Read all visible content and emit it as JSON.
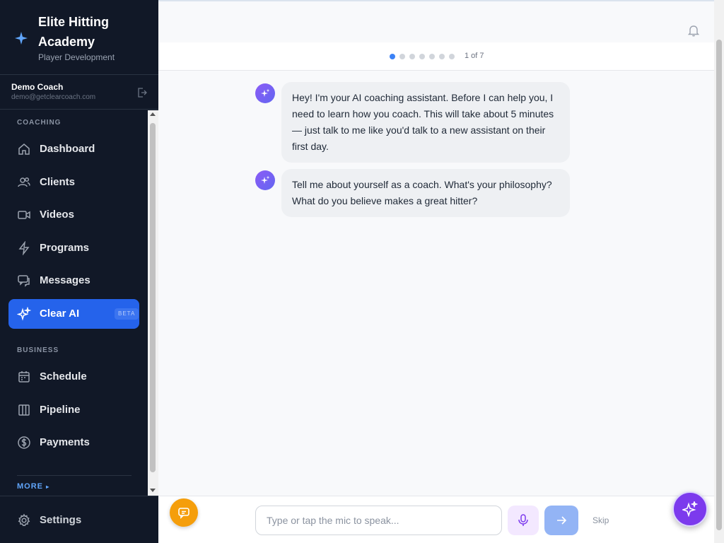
{
  "brand": {
    "title": "Elite Hitting Academy",
    "subtitle": "Player Development",
    "star_icon": "sparkle-icon"
  },
  "user": {
    "name": "Demo Coach",
    "email": "demo@getclearcoach.com",
    "logout_icon": "logout-icon"
  },
  "nav": {
    "coaching_label": "COACHING",
    "business_label": "BUSINESS",
    "more_label": "MORE",
    "items": [
      {
        "label": "Dashboard",
        "icon": "home-icon"
      },
      {
        "label": "Clients",
        "icon": "users-icon"
      },
      {
        "label": "Videos",
        "icon": "video-icon"
      },
      {
        "label": "Programs",
        "icon": "bolt-icon"
      },
      {
        "label": "Messages",
        "icon": "messages-icon"
      },
      {
        "label": "Clear AI",
        "icon": "sparkles-icon",
        "badge": "BETA",
        "active": true
      },
      {
        "label": "Schedule",
        "icon": "calendar-icon"
      },
      {
        "label": "Pipeline",
        "icon": "columns-icon"
      },
      {
        "label": "Payments",
        "icon": "dollar-icon"
      }
    ],
    "settings_label": "Settings"
  },
  "progress": {
    "current": 1,
    "total": 7,
    "text": "1 of 7"
  },
  "chat": {
    "messages": [
      "Hey! I'm your AI coaching assistant. Before I can help you, I need to learn how you coach. This will take about 5 minutes — just talk to me like you'd talk to a new assistant on their first day.",
      "Tell me about yourself as a coach. What's your philosophy? What do you believe makes a great hitter?"
    ]
  },
  "composer": {
    "placeholder": "Type or tap the mic to speak...",
    "value": "",
    "skip_label": "Skip"
  },
  "colors": {
    "sidebar_bg": "#111827",
    "accent": "#2563eb",
    "ai_purple": "#7c3aed",
    "chat_fab": "#f59e0b"
  }
}
